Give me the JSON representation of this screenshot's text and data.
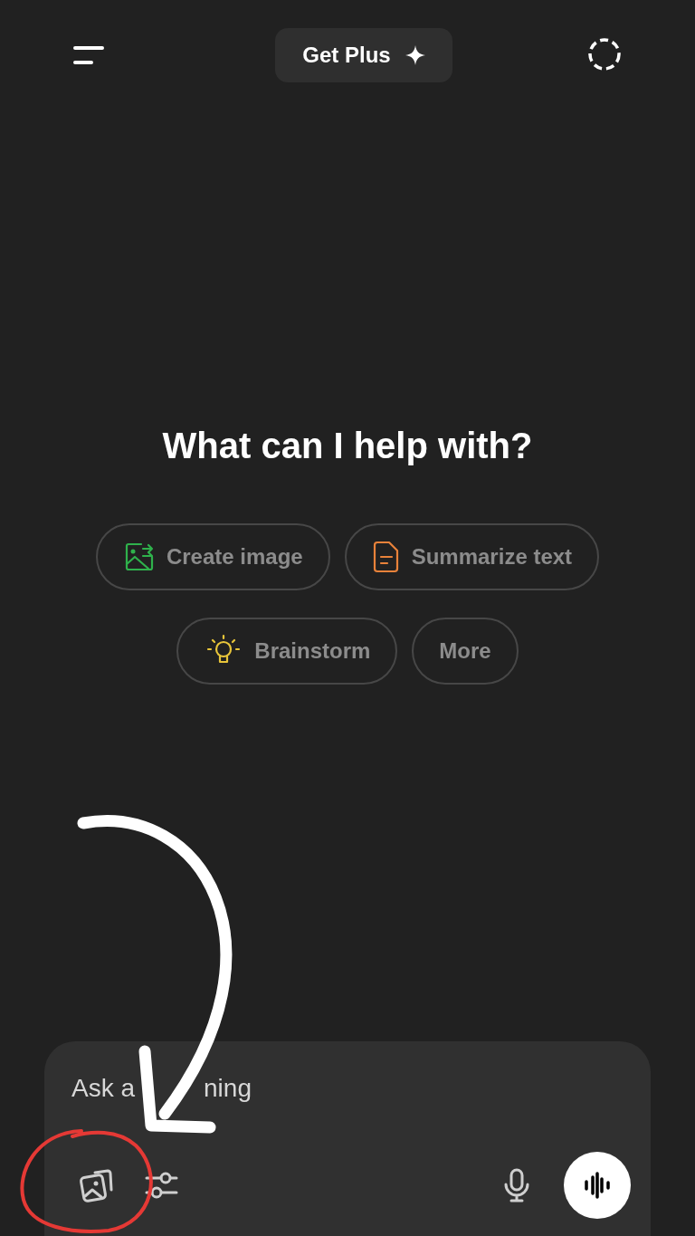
{
  "header": {
    "upgrade_button": "Get Plus"
  },
  "heading": "What can I help with?",
  "suggestions": [
    {
      "label": "Create image",
      "kind": "image",
      "color": "#2fb24c"
    },
    {
      "label": "Summarize text",
      "kind": "document",
      "color": "#e8823a"
    },
    {
      "label": "Brainstorm",
      "kind": "bulb",
      "color": "#e8c53a"
    },
    {
      "label": "More",
      "kind": "plain"
    }
  ],
  "composer": {
    "placeholder_parts": [
      "Ask a",
      "ning"
    ]
  },
  "annotation": {
    "highlighted": true
  }
}
